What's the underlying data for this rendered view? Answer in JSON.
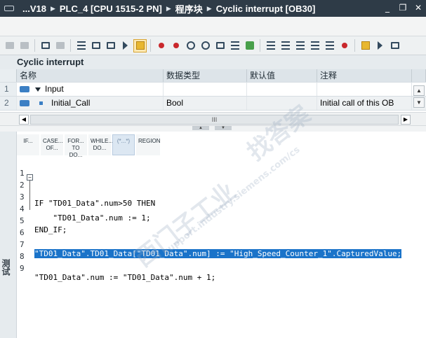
{
  "title_bar": {
    "breadcrumbs": [
      "...V18",
      "PLC_4 [CPU 1515-2 PN]",
      "程序块",
      "Cyclic interrupt [OB30]"
    ],
    "separator_icon": "triangle-right-icon",
    "window_controls": [
      "minimize-icon",
      "restore-icon",
      "close-icon"
    ]
  },
  "block_title": "Cyclic interrupt",
  "table": {
    "columns": [
      "名称",
      "数据类型",
      "默认值",
      "注释"
    ],
    "rows": [
      {
        "index": "1",
        "name": "Input",
        "type": "",
        "default": "",
        "comment": ""
      },
      {
        "index": "2",
        "name": "Initial_Call",
        "type": "Bool",
        "default": "",
        "comment": "Initial call of this OB"
      }
    ],
    "hscroll_thumb": "III"
  },
  "scl_toolbar": [
    {
      "label": "IF...",
      "selected": false
    },
    {
      "label": "CASE...\nOF...",
      "selected": false
    },
    {
      "label": "FOR...\nTO DO...",
      "selected": false
    },
    {
      "label": "WHILE...\nDO...",
      "selected": false
    },
    {
      "label": "(*...*)",
      "selected": true
    },
    {
      "label": "REGION",
      "selected": false
    }
  ],
  "side_label": "测试",
  "code": {
    "lines": [
      {
        "n": "1",
        "text": ""
      },
      {
        "n": "2",
        "text": "IF \"TD01_Data\".num>50 THEN"
      },
      {
        "n": "3",
        "text": ""
      },
      {
        "n": "4",
        "text": "    \"TD01_Data\".num := 1;"
      },
      {
        "n": "5",
        "text": "END_IF;"
      },
      {
        "n": "6",
        "text": ""
      },
      {
        "n": "7",
        "text": "\"TD01_Data\".TD01_Data[\"TD01_Data\".num] := \"High_Speed_Counter_1\".CapturedValue;"
      },
      {
        "n": "8",
        "text": ""
      },
      {
        "n": "9",
        "text": "\"TD01_Data\".num := \"TD01_Data\".num + 1;"
      }
    ],
    "highlighted_line": "7"
  },
  "watermark": [
    "西门子工业",
    "support.industry.siemens.com/cs",
    "找答案"
  ]
}
